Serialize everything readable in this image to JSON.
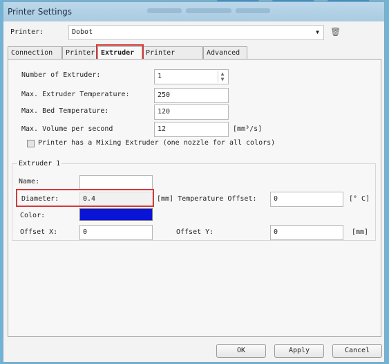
{
  "window": {
    "title": "Printer Settings",
    "title_blur_text": ""
  },
  "printer": {
    "label": "Printer:",
    "value": "Dobot",
    "dropdown_arrow": "▼",
    "trash_icon": "🗑"
  },
  "tabs": [
    {
      "label": "Connection"
    },
    {
      "label": "Printer"
    },
    {
      "label": "Extruder",
      "active": true
    },
    {
      "label": "Printer Shape"
    },
    {
      "label": "Advanced"
    }
  ],
  "extruder_settings": {
    "num_extruder_label": "Number of Extruder:",
    "num_extruder_value": "1",
    "max_extruder_temp_label": "Max. Extruder Temperature:",
    "max_extruder_temp_value": "250",
    "max_bed_temp_label": "Max. Bed Temperature:",
    "max_bed_temp_value": "120",
    "max_volume_label": "Max. Volume per second",
    "max_volume_value": "12",
    "max_volume_unit": "[mm³/s]",
    "mixing_label": "Printer has a Mixing Extruder (one nozzle for all colors)"
  },
  "extruder1": {
    "group_title": "Extruder 1",
    "name_label": "Name:",
    "name_value": "",
    "diameter_label": "Diameter:",
    "diameter_value": "0.4",
    "diameter_unit_and_offset_label": "[mm] Temperature Offset:",
    "temp_offset_value": "0",
    "temp_offset_unit": "[° C]",
    "color_label": "Color:",
    "color_value": "#0a14d6",
    "offset_x_label": "Offset X:",
    "offset_x_value": "0",
    "offset_y_label": "Offset Y:",
    "offset_y_value": "0",
    "offset_unit": "[mm]"
  },
  "buttons": {
    "ok": "OK",
    "apply": "Apply",
    "cancel": "Cancel"
  },
  "colors": {
    "highlight": "#d23a3a",
    "titlebar": "#bcd7ea",
    "backdrop": "#6fb4d6"
  }
}
